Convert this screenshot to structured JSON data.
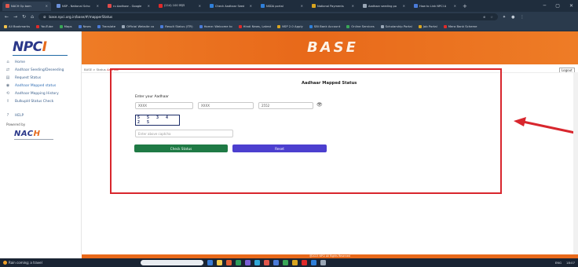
{
  "browser": {
    "tabs": [
      {
        "label": "NACH Op bom",
        "color": "#e2574c"
      },
      {
        "label": "NSP - National Scho",
        "color": "#6a8fd8"
      },
      {
        "label": "ru Aadhaar - Google",
        "color": "#de4b4b"
      },
      {
        "label": "(214) 100 लाइव",
        "color": "#e02a2a"
      },
      {
        "label": "Check Aadhaar Seed",
        "color": "#2f7fd9"
      },
      {
        "label": "NSDA portal",
        "color": "#2f7fd9"
      },
      {
        "label": "National Payments",
        "color": "#d9a51f"
      },
      {
        "label": "Aadhaar seeding po",
        "color": "#9aa7b6"
      },
      {
        "label": "How to Link NPCI A",
        "color": "#4a7bd8"
      }
    ],
    "active_tab_index": 0,
    "new_tab": "+",
    "url": "base.npci.org.in/base/#/mapperStatus",
    "bookmarks": [
      {
        "label": "All Bookmarks",
        "color": "#f3c34c"
      },
      {
        "label": "YouTube",
        "color": "#e02a2a"
      },
      {
        "label": "Maps",
        "color": "#3aa757"
      },
      {
        "label": "News",
        "color": "#4a7bd8"
      },
      {
        "label": "Translate",
        "color": "#4a7bd8"
      },
      {
        "label": "Official Website co",
        "color": "#9aa7b6"
      },
      {
        "label": "Result Status (ITR)",
        "color": "#4a7bd8"
      },
      {
        "label": "Home: Welcome to",
        "color": "#4a7bd8"
      },
      {
        "label": "Hindi News, Latest",
        "color": "#e02a2a"
      },
      {
        "label": "NSP 2.0 Apply",
        "color": "#d9a51f"
      },
      {
        "label": "SBI Bank Account",
        "color": "#2f7fd9"
      },
      {
        "label": "Online Services",
        "color": "#3aa757"
      },
      {
        "label": "Scholarship Portal",
        "color": "#9aa7b6"
      },
      {
        "label": "Job Portal",
        "color": "#d9a51f"
      },
      {
        "label": "Mera Bank Scheme",
        "color": "#e02a2a"
      }
    ]
  },
  "sidebar": {
    "items": [
      {
        "label": "Home",
        "icon": "home-icon",
        "glyph": "⌂"
      },
      {
        "label": "Aadhaar Seeding/Deseeding",
        "icon": "link-icon",
        "glyph": "⇄"
      },
      {
        "label": "Request Status",
        "icon": "document-icon",
        "glyph": "▤"
      },
      {
        "label": "Aadhaar Mapped status",
        "icon": "status-icon",
        "glyph": "◉"
      },
      {
        "label": "Aadhaar Mapping History",
        "icon": "history-icon",
        "glyph": "⟲"
      },
      {
        "label": "Bulkupld Status Check",
        "icon": "upload-icon",
        "glyph": "⇪"
      },
      {
        "label": "HELP",
        "icon": "help-icon",
        "glyph": "?"
      }
    ],
    "active_index": 3,
    "powered_by": "Powered by"
  },
  "header": {
    "logo": "BASE",
    "breadcrumb_prefix": "BASE > Status",
    "breadcrumb_current": "Aadhaar",
    "logout": "Logout"
  },
  "form": {
    "title": "Aadhaar Mapped Status",
    "enter_label": "Enter your Aadhaar",
    "aadhaar_part1": "XXXX",
    "aadhaar_part2": "XXXX",
    "aadhaar_part3": "2552",
    "captcha_text": "5 5 3 4 2 5",
    "captcha_placeholder": "Enter above captcha",
    "check_button": "Check Status",
    "reset_button": "Reset"
  },
  "footer": {
    "text": "@2023 NPCI All Rights Reserved"
  },
  "taskbar": {
    "weather": "Rain coming; a travel",
    "tray_text": "ENG",
    "time": "18:07"
  },
  "colors": {
    "brand_orange": "#e8691a",
    "brand_blue": "#2a3789",
    "annotation_red": "#d8262d",
    "check_green": "#1f7a45",
    "reset_purple": "#4c3fcf"
  }
}
